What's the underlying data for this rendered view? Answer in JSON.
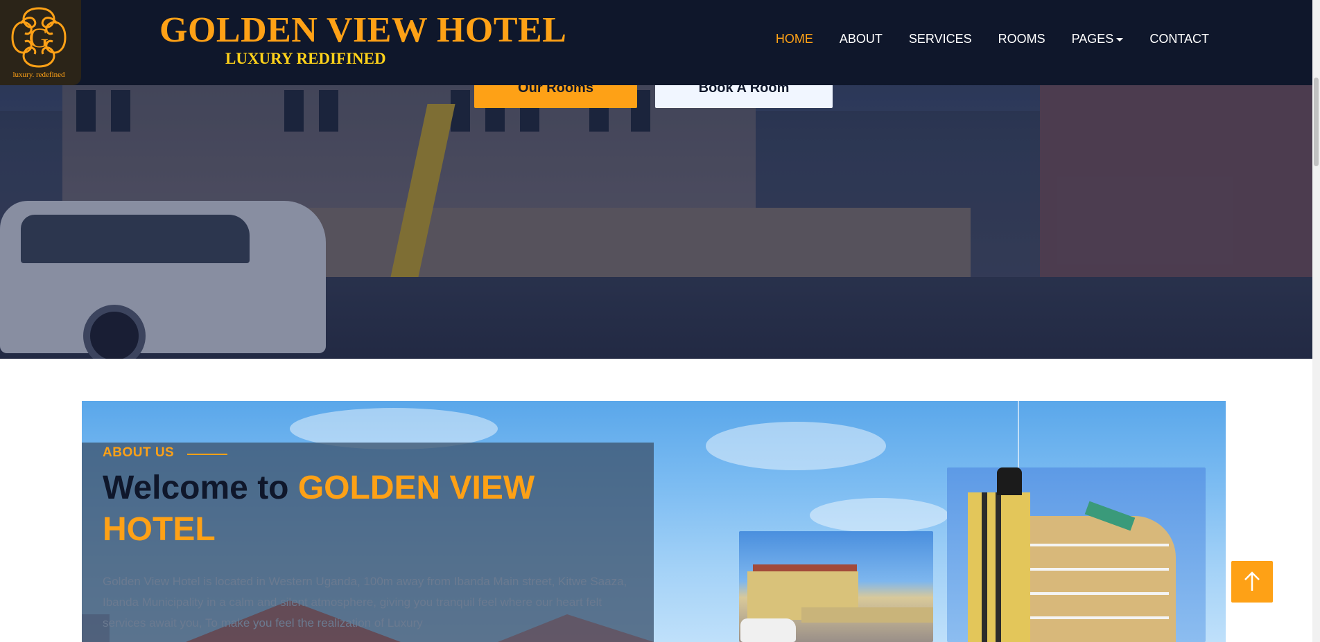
{
  "header": {
    "logo_letter": "G",
    "logo_tagline": "luxury. redefined",
    "brand_name": "GOLDEN VIEW HOTEL",
    "tagline": "LUXURY REDIFINED",
    "nav": [
      {
        "label": "HOME",
        "active": true
      },
      {
        "label": "ABOUT",
        "active": false
      },
      {
        "label": "SERVICES",
        "active": false
      },
      {
        "label": "ROOMS",
        "active": false
      },
      {
        "label": "PAGES",
        "active": false,
        "dropdown": true
      },
      {
        "label": "CONTACT",
        "active": false
      }
    ]
  },
  "hero": {
    "primary_button": "Our Rooms",
    "secondary_button": "Book A Room"
  },
  "about": {
    "label": "ABOUT US",
    "title_prefix": "Welcome to ",
    "title_highlight": "GOLDEN VIEW HOTEL",
    "text": "Golden View Hotel is located in Western Uganda, 100m away from Ibanda Main street, Kitwe Saaza, Ibanda Municipality in a calm and silent atmosphere, giving you tranquil feel where our heart felt services await you, To make you feel the realization of Luxury"
  },
  "colors": {
    "accent": "#fea116",
    "dark": "#0f172b",
    "tagline": "#ffd21a"
  },
  "icons": {
    "back_to_top": "arrow-up-icon",
    "logo": "ornate-g-logo"
  }
}
